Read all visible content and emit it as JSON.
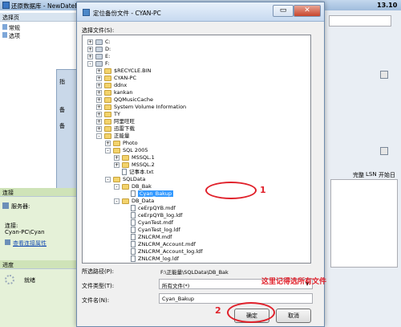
{
  "background_window": {
    "title": "还原数据库 - NewDateBas",
    "select_page_header": "选择页",
    "pages": [
      "常规",
      "选项"
    ],
    "connection_header": "连接",
    "server_label": "服务器:",
    "connection_label": "连接:",
    "connection_value": "Cyan-PC\\Cyan",
    "view_connection_link": "查看连接属性",
    "progress_header": "进度",
    "progress_status": "就绪",
    "mid_labels": [
      "指",
      "备",
      "备"
    ],
    "right_values": [
      "13.10",
      "完整",
      "LSN",
      "开始日"
    ]
  },
  "dialog": {
    "title": "定位备份文件 - CYAN-PC",
    "select_file_label": "选择文件(S):",
    "tree": [
      {
        "label": "C:",
        "indent": 0,
        "kind": "drive",
        "expander": "+"
      },
      {
        "label": "D:",
        "indent": 0,
        "kind": "drive",
        "expander": "+"
      },
      {
        "label": "E:",
        "indent": 0,
        "kind": "drive",
        "expander": "+"
      },
      {
        "label": "F:",
        "indent": 0,
        "kind": "drive",
        "expander": "-"
      },
      {
        "label": "$RECYCLE.BIN",
        "indent": 1,
        "kind": "folder",
        "expander": "+"
      },
      {
        "label": "CYAN-PC",
        "indent": 1,
        "kind": "folder",
        "expander": "+"
      },
      {
        "label": "ddnx",
        "indent": 1,
        "kind": "folder",
        "expander": "+"
      },
      {
        "label": "kankan",
        "indent": 1,
        "kind": "folder",
        "expander": "+"
      },
      {
        "label": "QQMusicCache",
        "indent": 1,
        "kind": "folder",
        "expander": "+"
      },
      {
        "label": "System Volume Information",
        "indent": 1,
        "kind": "folder",
        "expander": "+"
      },
      {
        "label": "TY",
        "indent": 1,
        "kind": "folder",
        "expander": "+"
      },
      {
        "label": "阿里旺旺",
        "indent": 1,
        "kind": "folder",
        "expander": "+"
      },
      {
        "label": "迅雷下载",
        "indent": 1,
        "kind": "folder",
        "expander": "+"
      },
      {
        "label": "正能量",
        "indent": 1,
        "kind": "folder",
        "expander": "-"
      },
      {
        "label": "Photo",
        "indent": 2,
        "kind": "folder",
        "expander": "+"
      },
      {
        "label": "SQL 2005",
        "indent": 2,
        "kind": "folder",
        "expander": "-"
      },
      {
        "label": "MSSQL.1",
        "indent": 3,
        "kind": "folder",
        "expander": "+"
      },
      {
        "label": "MSSQL.2",
        "indent": 3,
        "kind": "folder",
        "expander": "+"
      },
      {
        "label": "记事本.txt",
        "indent": 3,
        "kind": "file",
        "expander": ""
      },
      {
        "label": "SQLData",
        "indent": 2,
        "kind": "folder",
        "expander": "-"
      },
      {
        "label": "DB_Bak",
        "indent": 3,
        "kind": "folder",
        "expander": "-"
      },
      {
        "label": "Cyan_Bakup",
        "indent": 4,
        "kind": "file",
        "expander": "",
        "selected": true
      },
      {
        "label": "DB_Data",
        "indent": 3,
        "kind": "folder",
        "expander": "-"
      },
      {
        "label": "ceErpQYB.mdf",
        "indent": 4,
        "kind": "file",
        "expander": ""
      },
      {
        "label": "ceErpQYB_log.ldf",
        "indent": 4,
        "kind": "file",
        "expander": ""
      },
      {
        "label": "CyanTest.mdf",
        "indent": 4,
        "kind": "file",
        "expander": ""
      },
      {
        "label": "CyanTest_log.ldf",
        "indent": 4,
        "kind": "file",
        "expander": ""
      },
      {
        "label": "ZNLCRM.mdf",
        "indent": 4,
        "kind": "file",
        "expander": ""
      },
      {
        "label": "ZNLCRM_Account.mdf",
        "indent": 4,
        "kind": "file",
        "expander": ""
      },
      {
        "label": "ZNLCRM_Account_log.ldf",
        "indent": 4,
        "kind": "file",
        "expander": ""
      },
      {
        "label": "ZNLCRM_log.ldf",
        "indent": 4,
        "kind": "file",
        "expander": ""
      }
    ],
    "path_label": "所选路径(P):",
    "path_value": "F:\\正能量\\SQLData\\DB_Bak",
    "filetype_label": "文件类型(T):",
    "filetype_value": "所有文件(*)",
    "filename_label": "文件名(N):",
    "filename_value": "Cyan_Bakup",
    "ok_label": "确定",
    "cancel_label": "取消"
  },
  "annotations": {
    "marker_1": "1",
    "marker_2": "2",
    "note": "这里记得选所有文件",
    "accent_color": "#e0202a"
  }
}
